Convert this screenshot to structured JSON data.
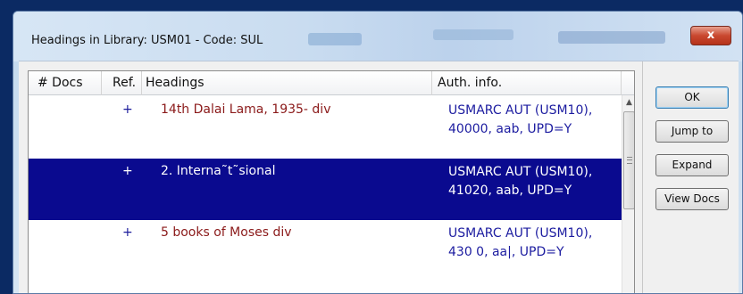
{
  "window": {
    "title": "Headings in Library: USM01 - Code: SUL",
    "close_glyph": "x"
  },
  "table": {
    "columns": [
      "# Docs",
      "Ref.",
      "Headings",
      "Auth. info."
    ],
    "rows": [
      {
        "docs": "",
        "ref": "+",
        "heading": "14th Dalai Lama, 1935- div",
        "auth": "USMARC AUT (USM10), 40000, aab, UPD=Y",
        "selected": false
      },
      {
        "docs": "",
        "ref": "+",
        "heading": "2. Interna˜t˜sional",
        "auth": "USMARC AUT (USM10), 41020, aab, UPD=Y",
        "selected": true
      },
      {
        "docs": "",
        "ref": "+",
        "heading": "5 books of Moses div",
        "auth": "USMARC AUT (USM10), 430 0, aa|, UPD=Y",
        "selected": false
      }
    ]
  },
  "buttons": {
    "ok": "OK",
    "jump_to": "Jump to",
    "expand": "Expand",
    "view_docs": "View Docs"
  },
  "colors": {
    "selection": "#0a0a8f",
    "heading_text": "#8b1a1a",
    "auth_text": "#1c1ca0",
    "screen_border": "#0b2a63"
  }
}
